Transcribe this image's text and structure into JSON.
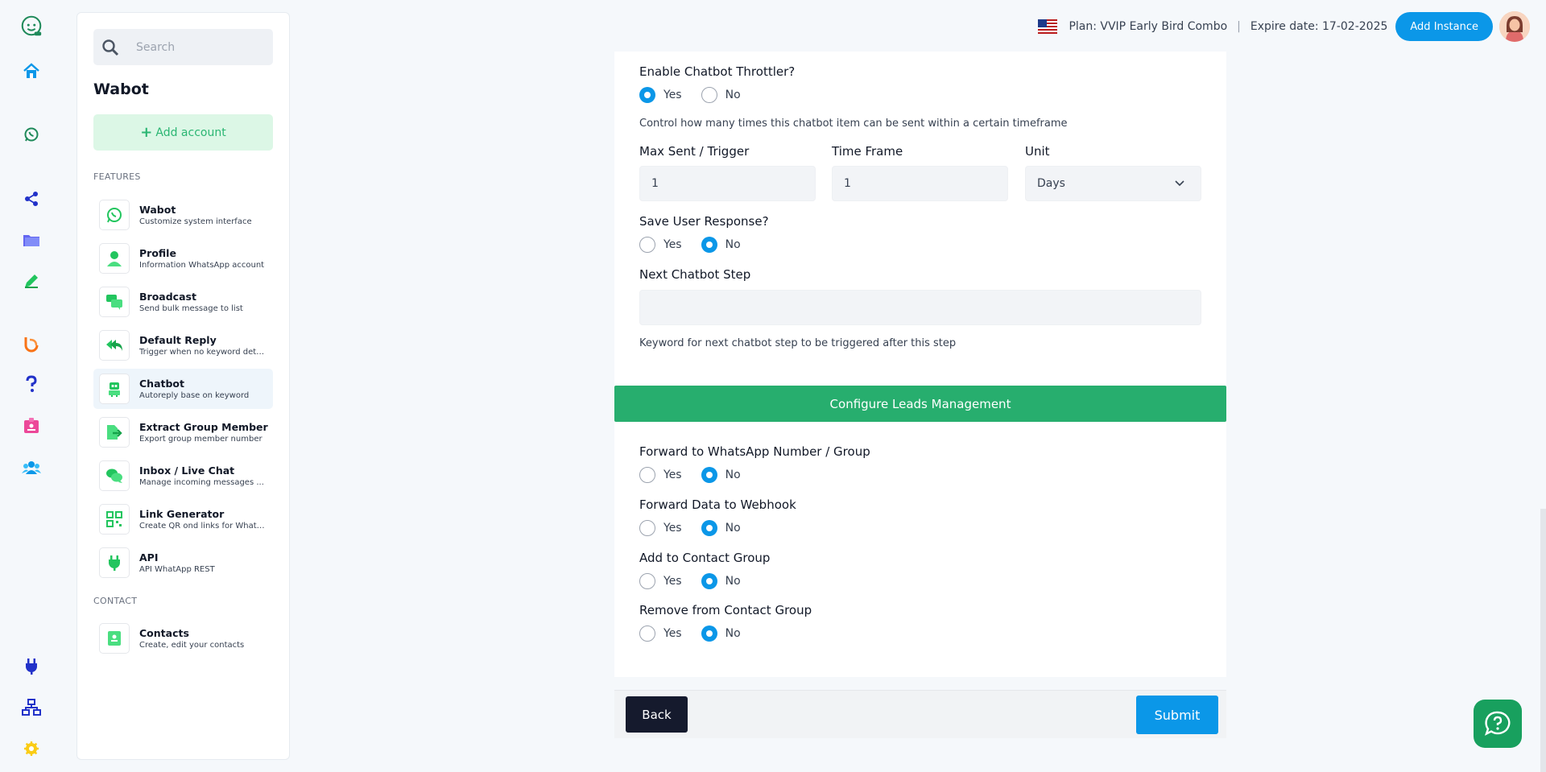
{
  "header": {
    "plan": "Plan: VVIP Early Bird Combo",
    "separator": "|",
    "expire": "Expire date: 17-02-2025",
    "add_instance_label": "Add Instance"
  },
  "sidebar": {
    "search_placeholder": "Search",
    "title": "Wabot",
    "add_account_label": "Add account",
    "features_label": "FEATURES",
    "contact_label": "CONTACT",
    "items": [
      {
        "title": "Wabot",
        "subtitle": "Customize system interface"
      },
      {
        "title": "Profile",
        "subtitle": "Information WhatsApp account"
      },
      {
        "title": "Broadcast",
        "subtitle": "Send bulk message to list"
      },
      {
        "title": "Default Reply",
        "subtitle": "Trigger when no keyword dete..."
      },
      {
        "title": "Chatbot",
        "subtitle": "Autoreply base on keyword"
      },
      {
        "title": "Extract Group Member",
        "subtitle": "Export group member number"
      },
      {
        "title": "Inbox / Live Chat",
        "subtitle": "Manage incoming messages ..."
      },
      {
        "title": "Link Generator",
        "subtitle": "Create QR ond links for Whats..."
      },
      {
        "title": "API",
        "subtitle": "API WhatApp REST"
      }
    ],
    "contacts": {
      "title": "Contacts",
      "subtitle": "Create, edit your contacts"
    }
  },
  "form": {
    "throttler_label": "Enable Chatbot Throttler?",
    "throttler_value": "Yes",
    "throttler_help": "Control how many times this chatbot item can be sent within a certain timeframe",
    "max_sent_label": "Max Sent / Trigger",
    "max_sent_value": "1",
    "time_frame_label": "Time Frame",
    "time_frame_value": "1",
    "unit_label": "Unit",
    "unit_value": "Days",
    "save_response_label": "Save User Response?",
    "save_response_value": "No",
    "next_step_label": "Next Chatbot Step",
    "next_step_value": "",
    "next_step_help": "Keyword for next chatbot step to be triggered after this step",
    "leads_button": "Configure Leads Management",
    "forward_wa_label": "Forward to WhatsApp Number / Group",
    "forward_wa_value": "No",
    "forward_webhook_label": "Forward Data to Webhook",
    "forward_webhook_value": "No",
    "add_group_label": "Add to Contact Group",
    "add_group_value": "No",
    "remove_group_label": "Remove from Contact Group",
    "remove_group_value": "No",
    "yes": "Yes",
    "no": "No"
  },
  "footer": {
    "back_label": "Back",
    "submit_label": "Submit"
  },
  "colors": {
    "primary": "#0b97e8",
    "green": "#27ae6e",
    "dark": "#151a2d"
  }
}
